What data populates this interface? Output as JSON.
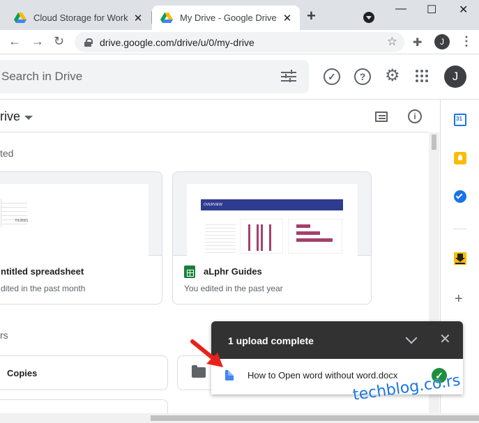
{
  "browser": {
    "tabs": [
      {
        "title": "Cloud Storage for Work and",
        "close": "✕"
      },
      {
        "title": "My Drive - Google Drive",
        "close": "✕"
      }
    ],
    "new_tab": "+",
    "window_controls": {
      "minimize": "—",
      "maximize": "☐",
      "close": "✕"
    },
    "url": "drive.google.com/drive/u/0/my-drive",
    "profile_initial": "J",
    "icons": [
      "back-icon",
      "forward-icon",
      "reload-icon",
      "lock-icon",
      "star-icon",
      "extensions-icon",
      "kebab-menu-icon",
      "tab-search-icon"
    ]
  },
  "drive": {
    "search_placeholder": "Search in Drive",
    "header_icons": [
      "search-options-icon",
      "ready-offline-icon",
      "support-icon",
      "settings-icon",
      "apps-icon"
    ],
    "avatar_initial": "J",
    "breadcrumb": "rive",
    "suggested_label": "ted",
    "files_label": "rs",
    "cards": [
      {
        "name": "ntitled spreadsheet",
        "subtitle": "dited in the past month",
        "thumb_date": "7/1/2021"
      },
      {
        "name": "aLphr Guides",
        "subtitle": "You edited in the past year",
        "thumb_header": "OVERVIEW"
      }
    ],
    "folders": [
      {
        "name": "Copies"
      },
      {
        "name": ""
      }
    ],
    "side_panel_icons": [
      "calendar-icon",
      "keep-icon",
      "tasks-icon",
      "download-icon",
      "add-icon"
    ],
    "calendar_day": "31"
  },
  "upload_panel": {
    "title": "1 upload complete",
    "file_name": "How to Open word without word.docx",
    "status": "complete"
  },
  "watermark": "techblog.co.rs",
  "colors": {
    "accent": "#1a73e8",
    "upload_header": "#323232",
    "success": "#1e8e3e",
    "arrow": "#e8221b",
    "sheet_green": "#188038",
    "chart_bar": "#a3406e"
  }
}
